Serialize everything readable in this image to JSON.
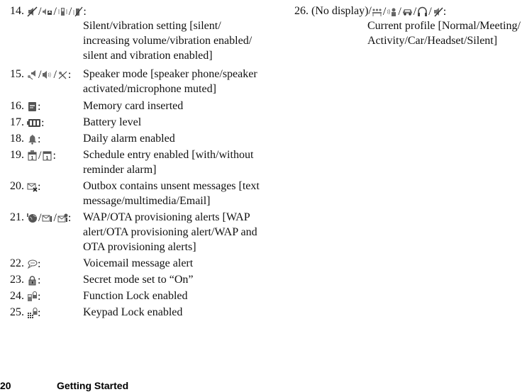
{
  "entries_left": [
    {
      "num": "14.",
      "icons": [
        "silent-icon",
        "increasing-volume-icon",
        "vibration-icon",
        "silent-vibration-icon"
      ],
      "desc_lines": [
        "Silent/vibration setting [silent/",
        "increasing volume/vibration enabled/",
        "silent and vibration enabled]"
      ]
    },
    {
      "num": "15.",
      "icons": [
        "speaker-phone-icon",
        "speaker-activated-icon",
        "microphone-muted-icon"
      ],
      "desc_lines": [
        "Speaker mode [speaker phone/speaker",
        "activated/microphone muted]"
      ]
    },
    {
      "num": "16.",
      "icons": [
        "memory-card-icon"
      ],
      "desc_lines": [
        "Memory card inserted"
      ]
    },
    {
      "num": "17.",
      "icons": [
        "battery-icon"
      ],
      "desc_lines": [
        "Battery level"
      ]
    },
    {
      "num": "18.",
      "icons": [
        "alarm-bell-icon"
      ],
      "desc_lines": [
        "Daily alarm enabled"
      ]
    },
    {
      "num": "19.",
      "icons": [
        "schedule-alarm-icon",
        "schedule-icon"
      ],
      "desc_lines": [
        "Schedule entry enabled [with/without",
        "reminder alarm]"
      ]
    },
    {
      "num": "20.",
      "icons": [
        "outbox-unsent-icon"
      ],
      "desc_lines": [
        "Outbox contains unsent messages [text",
        "message/multimedia/Email]"
      ]
    },
    {
      "num": "21.",
      "icons": [
        "wap-alert-icon",
        "ota-alert-icon",
        "wap-ota-alert-icon"
      ],
      "desc_lines": [
        "WAP/OTA provisioning alerts [WAP",
        "alert/OTA provisioning alert/WAP and",
        "OTA provisioning alerts]"
      ]
    },
    {
      "num": "22.",
      "icons": [
        "voicemail-icon"
      ],
      "desc_lines": [
        "Voicemail message alert"
      ]
    },
    {
      "num": "23.",
      "icons": [
        "secret-lock-icon"
      ],
      "desc_lines": [
        "Secret mode set to “On”"
      ]
    },
    {
      "num": "24.",
      "icons": [
        "function-lock-icon"
      ],
      "desc_lines": [
        "Function Lock enabled"
      ]
    },
    {
      "num": "25.",
      "icons": [
        "keypad-lock-icon"
      ],
      "desc_lines": [
        "Keypad Lock enabled"
      ]
    }
  ],
  "entries_right": [
    {
      "num": "26.",
      "prefix": "(No display)/",
      "icons": [
        "meeting-profile-icon",
        "activity-profile-icon",
        "car-profile-icon",
        "headset-profile-icon",
        "silent-profile-icon"
      ],
      "desc_lines": [
        "Current profile [Normal/Meeting/",
        "Activity/Car/Headset/Silent]"
      ]
    }
  ],
  "footer": {
    "page_number": "20",
    "section_title": "Getting Started"
  }
}
